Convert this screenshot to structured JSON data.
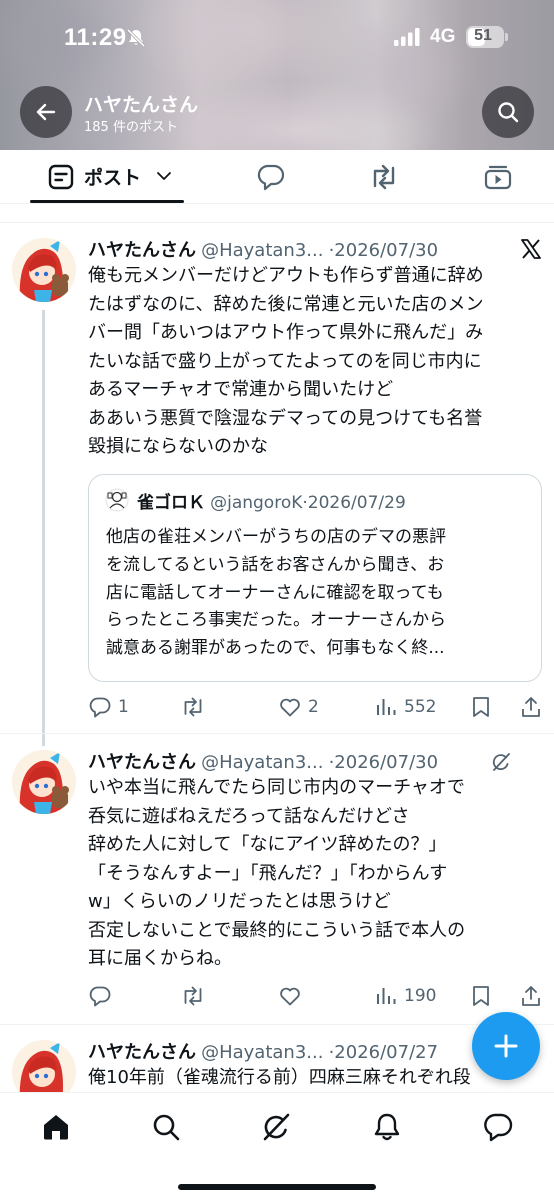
{
  "status_bar": {
    "time": "11:29",
    "network": "4G",
    "battery": "51",
    "battery_level": 0.51
  },
  "header": {
    "title": "ハヤたんさん",
    "subtitle": "185 件のポスト"
  },
  "tabs": [
    {
      "label": "ポスト",
      "icon": "posts-icon",
      "selected": true
    },
    {
      "icon": "reply-bubble-icon"
    },
    {
      "icon": "repost-icon"
    },
    {
      "icon": "media-icon"
    }
  ],
  "posts": [
    {
      "author": "ハヤたんさん",
      "handle": "@Hayatan3...",
      "dot": "·",
      "date": "2026/07/30",
      "badge_icon": "x-logo-icon",
      "lines": [
        "俺も元メンバーだけどアウトも作らず普通に辞め",
        "たはずなのに、辞めた後に常連と元いた店のメン",
        "バー間「あいつはアウト作って県外に飛んだ」み",
        "たいな話で盛り上がってたよってのを同じ市内に",
        "あるマーチャオで常連から聞いたけど",
        "ああいう悪質で陰湿なデマっての見つけても名誉",
        "毀損にならないのかな"
      ],
      "quote": {
        "author": "雀ゴロＫ",
        "handle": "@jangoroK",
        "dot": "·",
        "date": "2026/07/29",
        "lines": [
          "他店の雀荘メンバーがうちの店のデマの悪評",
          "を流してるという話をお客さんから聞き、お",
          "店に電話してオーナーさんに確認を取っても",
          "らったところ事実だった。オーナーさんから",
          "誠意ある謝罪があったので、何事もなく終..."
        ]
      },
      "stats": {
        "replies": "1",
        "reposts": "",
        "likes": "2",
        "views": "552"
      }
    },
    {
      "author": "ハヤたんさん",
      "handle": "@Hayatan3...",
      "dot": "·",
      "date": "2026/07/30",
      "badge_icon": "grok-icon",
      "lines": [
        "いや本当に飛んでたら同じ市内のマーチャオで",
        "呑気に遊ばねえだろって話なんだけどさ",
        "辞めた人に対して「なにアイツ辞めたの？」",
        "「そうなんすよー」「飛んだ？」「わからんす",
        "w」くらいのノリだったとは思うけど",
        "否定しないことで最終的にこういう話で本人の",
        "耳に届くからね。"
      ],
      "stats": {
        "replies": "",
        "reposts": "",
        "likes": "",
        "views": "190"
      }
    },
    {
      "author": "ハヤたんさん",
      "handle": "@Hayatan3...",
      "dot": "·",
      "date": "2026/07/27",
      "lines": [
        "俺10年前（雀魂流行る前）四麻三麻それぞれ段"
      ]
    }
  ],
  "bottom_nav": [
    {
      "icon": "home-icon",
      "selected": true
    },
    {
      "icon": "search-icon"
    },
    {
      "icon": "grok-icon"
    },
    {
      "icon": "notifications-icon"
    },
    {
      "icon": "messages-icon"
    }
  ],
  "colors": {
    "accent": "#1d9bf0",
    "text": "#0f1419",
    "muted": "#536471",
    "border": "#cfd9de"
  }
}
